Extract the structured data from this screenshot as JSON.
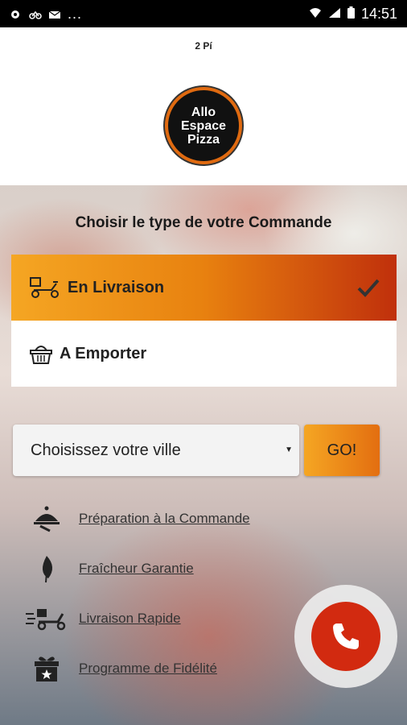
{
  "status_bar": {
    "time": "14:51",
    "dots": "..."
  },
  "header": {
    "subtitle": "2 Pí",
    "logo_lines": [
      "Allo",
      "Espace",
      "Pizza"
    ]
  },
  "order_type": {
    "title": "Choisir le type de votre Commande",
    "options": [
      {
        "label": "En Livraison",
        "icon": "delivery-scooter-icon",
        "selected": true
      },
      {
        "label": "A Emporter",
        "icon": "basket-icon",
        "selected": false
      }
    ]
  },
  "city": {
    "placeholder": "Choisissez votre ville",
    "go_label": "GO!"
  },
  "features": [
    {
      "label": "Préparation à la Commande",
      "icon": "cloche-icon"
    },
    {
      "label": "Fraîcheur Garantie",
      "icon": "leaf-icon"
    },
    {
      "label": "Livraison Rapide",
      "icon": "fast-scooter-icon"
    },
    {
      "label": "Programme de Fidélité",
      "icon": "gift-icon"
    }
  ],
  "colors": {
    "accent_start": "#f5a623",
    "accent_end": "#c0300c",
    "call_red": "#d22a10"
  }
}
